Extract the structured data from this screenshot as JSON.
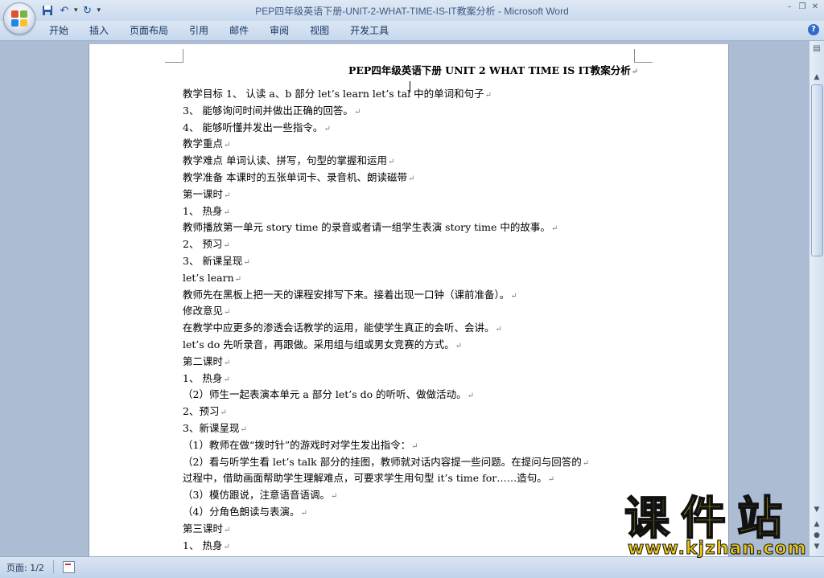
{
  "window": {
    "doc_name": "PEP四年级英语下册-UNIT-2-WHAT-TIME-IS-IT教案分析",
    "separator": " - ",
    "app_name": "Microsoft Word"
  },
  "ribbon": {
    "tabs": [
      "开始",
      "插入",
      "页面布局",
      "引用",
      "邮件",
      "审阅",
      "视图",
      "开发工具"
    ]
  },
  "document": {
    "title": "PEP四年级英语下册 UNIT 2 WHAT TIME IS IT教案分析",
    "paragraph_mark": "↵",
    "lines": [
      "教学目标 1、 认读 a、b 部分 let’s learn let’s tal 中的单词和句子",
      "3、 能够询问时间并做出正确的回答。",
      "4、 能够听懂并发出一些指令。",
      "教学重点",
      "教学难点 单词认读、拼写，句型的掌握和运用",
      "教学准备 本课时的五张单词卡、录音机、朗读磁带",
      "第一课时",
      "1、 热身",
      "教师播放第一单元 story time 的录音或者请一组学生表演 story time 中的故事。",
      "2、 预习",
      "3、 新课呈现",
      "let’s learn",
      "教师先在黑板上把一天的课程安排写下来。接着出现一口钟（课前准备）。",
      " 修改意见",
      " 在教学中应更多的渗透会话教学的运用，能使学生真正的会听、会讲。",
      "let’s do 先听录音，再跟做。采用组与组或男女竞赛的方式。",
      "第二课时",
      "1、 热身",
      "（2）师生一起表演本单元 a 部分 let’s do 的听听、做做活动。",
      "2、预习",
      "3、新课呈现",
      "（1）教师在做“拨时针”的游戏时对学生发出指令：",
      "（2）看与听学生看 let’s talk 部分的挂图，教师就对话内容提一些问题。在提问与回答的",
      "过程中，借助画面帮助学生理解难点，可要求学生用句型 it’s time for……造句。",
      "（3）模仿跟说，注意语音语调。",
      "（4）分角色朗读与表演。",
      "第三课时",
      "1、 热身"
    ]
  },
  "statusbar": {
    "page_label": "页面: 1/2"
  },
  "watermark": {
    "cn": "课件站",
    "url": "www.kjzhan.com"
  },
  "colors": {
    "titlebar": "#dfe9f5",
    "workspace": "#abbcd3",
    "watermark": "#f7d21c"
  }
}
